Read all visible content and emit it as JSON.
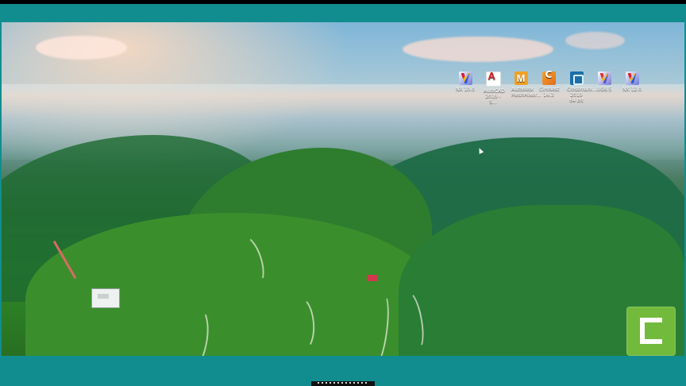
{
  "desktop": {
    "icons": [
      {
        "label": "NX 10.0",
        "icon": "nx-icon"
      },
      {
        "label": "AutoCAD 2019 - S...",
        "icon": "autocad-icon"
      },
      {
        "label": "Autodesk MeshMixer...",
        "icon": "maya-icon"
      },
      {
        "label": "CimNest 14.3",
        "icon": "cimatron-icon"
      },
      {
        "label": "Crossmark... 2019 64 bit",
        "icon": "crossmark-icon"
      },
      {
        "label": "UG8.5",
        "icon": "ug-icon"
      },
      {
        "label": "NX 12.0",
        "icon": "nx-icon"
      }
    ]
  },
  "overlay": {
    "logo": "camtasia-icon"
  },
  "colors": {
    "frame": "#128d8f",
    "topbar": "#000000",
    "camtasia": "#72ba3b"
  }
}
